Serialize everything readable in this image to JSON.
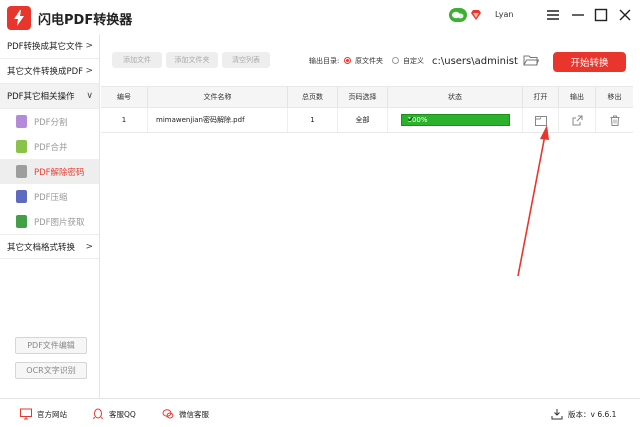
{
  "app": {
    "title": "闪电PDF转换器",
    "user": "Lyan"
  },
  "sidebar": {
    "groups": [
      {
        "label": "PDF转换成其它文件",
        "chevron": ">"
      },
      {
        "label": "其它文件转换成PDF",
        "chevron": ">"
      },
      {
        "label": "PDF其它相关操作",
        "chevron": "∨"
      }
    ],
    "items": [
      {
        "label": "PDF分割",
        "color": "#b38bd9"
      },
      {
        "label": "PDF合并",
        "color": "#8bc34a"
      },
      {
        "label": "PDF解除密码",
        "color": "#9e9e9e",
        "active": true
      },
      {
        "label": "PDF压缩",
        "color": "#5c6bc0"
      },
      {
        "label": "PDF图片获取",
        "color": "#43a047"
      }
    ],
    "last_group": {
      "label": "其它文档格式转换",
      "chevron": ">"
    },
    "buttons": {
      "edit": "PDF文件编辑",
      "ocr": "OCR文字识别"
    }
  },
  "toolbar": {
    "add_file": "添加文件",
    "add_folder": "添加文件夹",
    "clear_list": "清空列表",
    "output_label": "输出目录:",
    "option_source": "原文件夹",
    "option_custom": "自定义",
    "path_value": "c:\\users\\administ",
    "start": "开始转换"
  },
  "table": {
    "headers": [
      "编号",
      "文件名称",
      "总页数",
      "页码选择",
      "状态",
      "打开",
      "输出",
      "移出"
    ],
    "rows": [
      {
        "index": "1",
        "filename": "mimawenjian密码解除.pdf",
        "pages": "1",
        "page_select": "全部",
        "progress_text": "100%",
        "progress": 1.0
      }
    ]
  },
  "statusbar": {
    "website": "官方网站",
    "qq": "客服QQ",
    "wechat": "微信客服",
    "version": "版本：v 6.6.1"
  },
  "colors": {
    "accent": "#e8362c",
    "progress": "#2bb12b"
  },
  "icons": [
    "app-logo-icon",
    "wechat-icon",
    "vip-icon",
    "menu-icon",
    "maximize-icon",
    "close-icon",
    "folder-icon",
    "open-folder-icon",
    "export-icon",
    "trash-icon",
    "monitor-icon",
    "qq-icon",
    "wechat-service-icon",
    "download-icon"
  ]
}
